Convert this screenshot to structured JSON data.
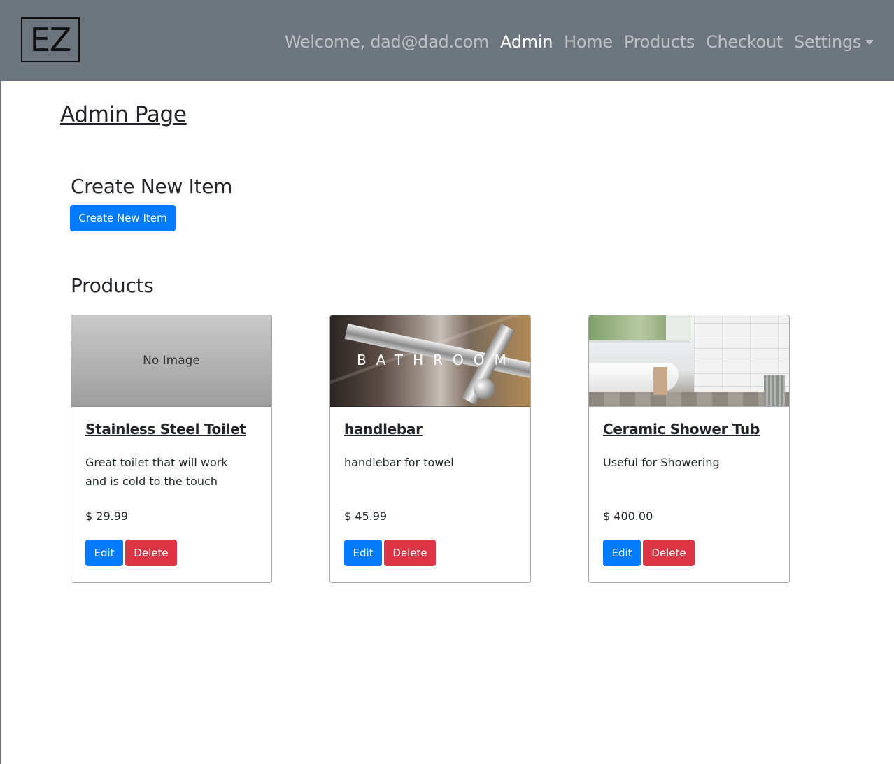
{
  "brand": {
    "logo_text": "EZ"
  },
  "nav": {
    "welcome": "Welcome, dad@dad.com",
    "links": [
      "Admin",
      "Home",
      "Products",
      "Checkout",
      "Settings"
    ],
    "active": "Admin"
  },
  "page": {
    "title": "Admin Page",
    "create_heading": "Create New Item",
    "create_button": "Create New Item",
    "products_heading": "Products"
  },
  "products": [
    {
      "image_text": "No Image",
      "name": "Stainless Steel Toilet",
      "description": "Great toilet that will work and is cold to the touch",
      "price": "$ 29.99",
      "edit_label": "Edit",
      "delete_label": "Delete"
    },
    {
      "image_overlay": "BATHROOM",
      "name": "handlebar",
      "description": "handlebar for towel",
      "price": "$ 45.99",
      "edit_label": "Edit",
      "delete_label": "Delete"
    },
    {
      "name": "Ceramic Shower Tub",
      "description": "Useful for Showering",
      "price": "$ 400.00",
      "edit_label": "Edit",
      "delete_label": "Delete"
    }
  ],
  "colors": {
    "navbar": "#6c757d",
    "primary": "#007bff",
    "danger": "#dc3545",
    "text": "#212529"
  }
}
